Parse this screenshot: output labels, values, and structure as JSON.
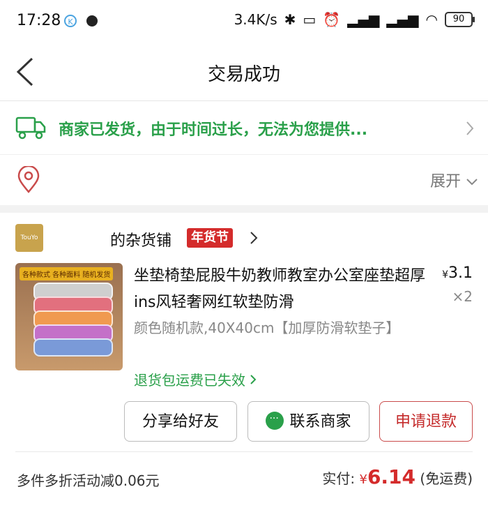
{
  "status_bar": {
    "time": "17:28",
    "net_speed": "3.4K/s",
    "battery": "90",
    "k_badge": "K"
  },
  "header": {
    "title": "交易成功"
  },
  "shipping": {
    "message": "商家已发货，由于时间过长，无法为您提供..."
  },
  "address": {
    "expand_label": "展开"
  },
  "shop": {
    "name": "的杂货铺",
    "badge": "年货节",
    "logo_text": "TouYo"
  },
  "product": {
    "title": "坐垫椅垫屁股牛奶教师教室办公室座垫超厚ins风轻奢网红软垫防滑",
    "price_symbol": "¥",
    "price": "3.1",
    "quantity": "×2",
    "spec": "颜色随机款,40X40cm【加厚防滑软垫子】",
    "return_note": "退货包运费已失效",
    "image_banner": "各种款式 各种面料 随机发货"
  },
  "actions": {
    "share": "分享给好友",
    "contact": "联系商家",
    "refund": "申请退款"
  },
  "summary": {
    "discount": "多件多折活动减0.06元",
    "paid_label": "实付:",
    "paid_symbol": "¥",
    "paid_amount": "6.14",
    "shipping_note": "(免运费)"
  },
  "colors": {
    "green": "#2aa04a",
    "red": "#d42b2b"
  }
}
